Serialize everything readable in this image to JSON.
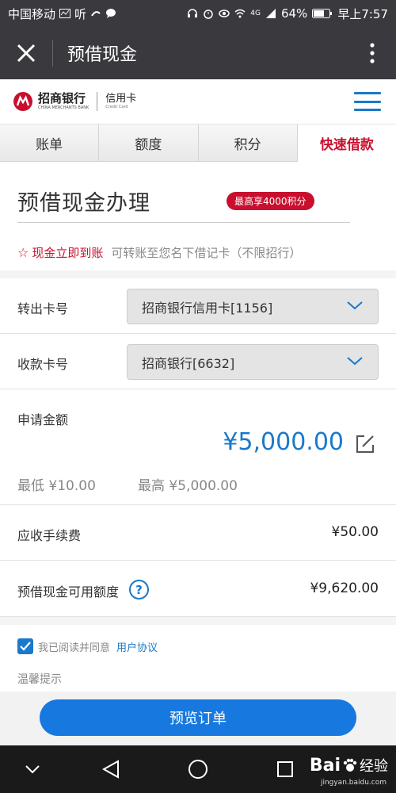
{
  "status_bar": {
    "carrier": "中国移动",
    "listen_label": "听",
    "signal": "4G",
    "battery": "64%",
    "time": "早上7:57"
  },
  "title_bar": {
    "title": "预借现金"
  },
  "brand": {
    "name_cn": "招商银行",
    "name_en": "CHINA MERCHANTS BANK",
    "card_cn": "信用卡",
    "card_en": "Credit Card"
  },
  "tabs": [
    {
      "label": "账单",
      "active": false
    },
    {
      "label": "额度",
      "active": false
    },
    {
      "label": "积分",
      "active": false
    },
    {
      "label": "快速借款",
      "active": true
    }
  ],
  "main": {
    "heading": "预借现金办理",
    "badge": "最高享4000积分",
    "promo_strong": "现金立即到账",
    "promo_sub": "可转账至您名下借记卡（不限招行）",
    "from_card_label": "转出卡号",
    "from_card_value": "招商银行信用卡[1156]",
    "to_card_label": "收款卡号",
    "to_card_value": "招商银行[6632]",
    "amount_label": "申请金额",
    "amount_value": "¥5,000.00",
    "amount_min": "最低 ¥10.00",
    "amount_max": "最高 ¥5,000.00",
    "fee_label": "应收手续费",
    "fee_value": "¥50.00",
    "available_label": "预借现金可用额度",
    "available_value": "¥9,620.00",
    "agree_text": "我已阅读并同意",
    "agree_link": "用户协议",
    "tip_label": "温馨提示",
    "submit_label": "预览订单"
  },
  "watermark": {
    "brand": "Bai",
    "suffix": "经验",
    "url": "jingyan.baidu.com"
  },
  "colors": {
    "accent_blue": "#1a79c9",
    "brand_red": "#c8102e",
    "button_blue": "#1779e0",
    "bar_dark": "#3a3a3e"
  }
}
